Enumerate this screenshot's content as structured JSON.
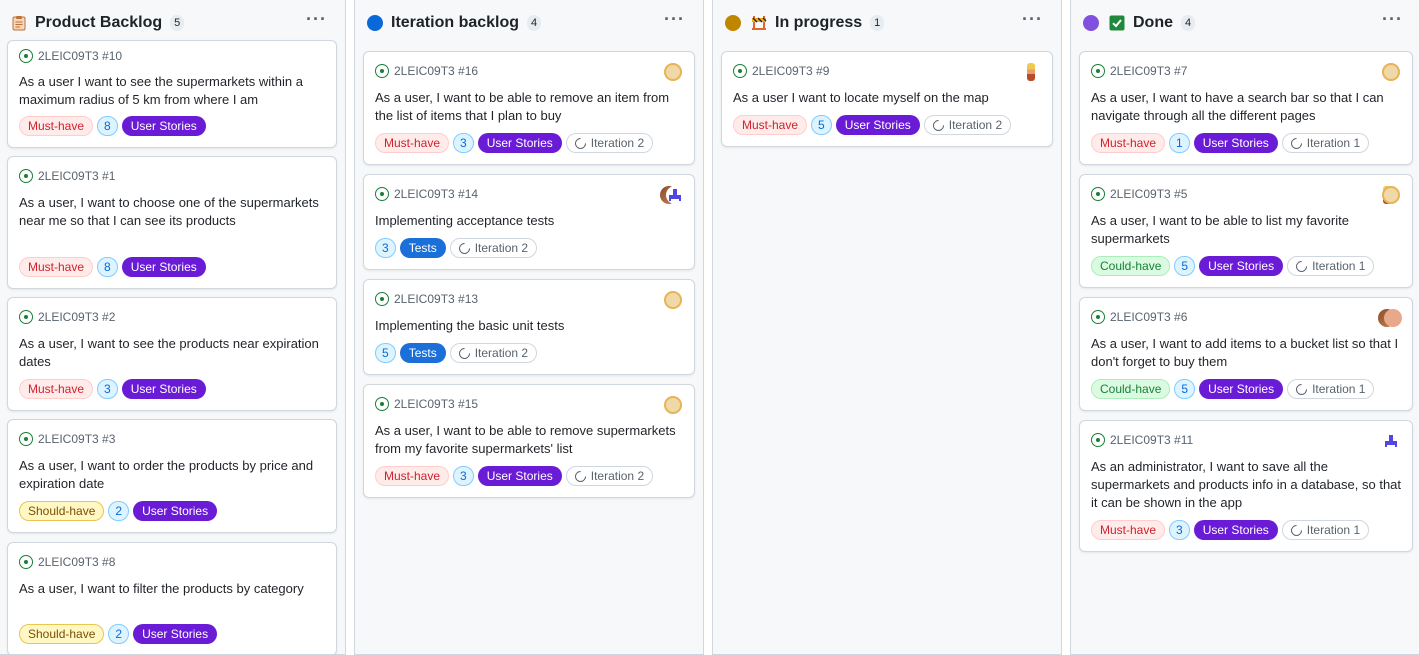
{
  "colors": {
    "backlog_icon": "#c2703a",
    "iteration_dot": "#0969da",
    "progress_dot": "#bf8700",
    "done_dot": "#8250df",
    "done_check": "#1f883d"
  },
  "columns": [
    {
      "title": "Product Backlog",
      "count": "5",
      "icon": "clipboard-icon",
      "cards": [
        {
          "ref": "2LEIC09T3 #10",
          "title": "As a user I want to see the supermarkets within a maximum radius of 5 km from where I am",
          "priority": "Must-have",
          "points": "8",
          "type": "User Stories",
          "iteration": ""
        },
        {
          "ref": "2LEIC09T3 #1",
          "title": "As a user, I want to choose one of the supermarkets near me so that I can see its products",
          "priority": "Must-have",
          "points": "8",
          "type": "User Stories",
          "iteration": ""
        },
        {
          "ref": "2LEIC09T3 #2",
          "title": "As a user, I want to see the products near expiration dates",
          "priority": "Must-have",
          "points": "3",
          "type": "User Stories",
          "iteration": ""
        },
        {
          "ref": "2LEIC09T3 #3",
          "title": "As a user, I want to order the products by price and expiration date",
          "priority": "Should-have",
          "points": "2",
          "type": "User Stories",
          "iteration": ""
        },
        {
          "ref": "2LEIC09T3 #8",
          "title": "As a user, I want to filter the products by category",
          "priority": "Should-have",
          "points": "2",
          "type": "User Stories",
          "iteration": ""
        }
      ]
    },
    {
      "title": "Iteration backlog",
      "count": "4",
      "icon": "blue-dot-icon",
      "cards": [
        {
          "ref": "2LEIC09T3 #16",
          "title": "As a user, I want to be able to remove an item from the list of items that I plan to buy",
          "priority": "Must-have",
          "points": "3",
          "type": "User Stories",
          "iteration": "Iteration 2",
          "avatar": "yellow"
        },
        {
          "ref": "2LEIC09T3 #14",
          "title": "Implementing acceptance tests",
          "priority": "",
          "points": "3",
          "type": "Tests",
          "iteration": "Iteration 2",
          "avatar": "pair-dark-blue"
        },
        {
          "ref": "2LEIC09T3 #13",
          "title": "Implementing the basic unit tests",
          "priority": "",
          "points": "5",
          "type": "Tests",
          "iteration": "Iteration 2",
          "avatar": "yellow"
        },
        {
          "ref": "2LEIC09T3 #15",
          "title": "As a user, I want to be able to remove supermarkets from my favorite supermarkets' list",
          "priority": "Must-have",
          "points": "3",
          "type": "User Stories",
          "iteration": "Iteration 2",
          "avatar": "yellow"
        }
      ]
    },
    {
      "title": "In progress",
      "count": "1",
      "icon": "construction-icon",
      "cards": [
        {
          "ref": "2LEIC09T3 #9",
          "title": "As a user I want to locate myself on the map",
          "priority": "Must-have",
          "points": "5",
          "type": "User Stories",
          "iteration": "Iteration 2",
          "avatar": "boy"
        }
      ]
    },
    {
      "title": "Done",
      "count": "4",
      "icon": "check-icon",
      "cards": [
        {
          "ref": "2LEIC09T3 #7",
          "title": "As a user, I want to have a search bar so that I can navigate through all the different pages",
          "priority": "Must-have",
          "points": "1",
          "type": "User Stories",
          "iteration": "Iteration 1",
          "avatar": "yellow"
        },
        {
          "ref": "2LEIC09T3 #5",
          "title": "As a user, I want to be able to list my favorite supermarkets",
          "priority": "Could-have",
          "points": "5",
          "type": "User Stories",
          "iteration": "Iteration 1",
          "avatar": "pair-boy-yellow"
        },
        {
          "ref": "2LEIC09T3 #6",
          "title": "As a user, I want to add items to a bucket list so that I don't forget to buy them",
          "priority": "Could-have",
          "points": "5",
          "type": "User Stories",
          "iteration": "Iteration 1",
          "avatar": "pair-dark-pink"
        },
        {
          "ref": "2LEIC09T3 #11",
          "title": "As an administrator, I want to save all the supermarkets and products info in a database, so that it can be shown in the app",
          "priority": "Must-have",
          "points": "3",
          "type": "User Stories",
          "iteration": "Iteration 1",
          "avatar": "blue"
        }
      ]
    }
  ],
  "menu_label": "···"
}
